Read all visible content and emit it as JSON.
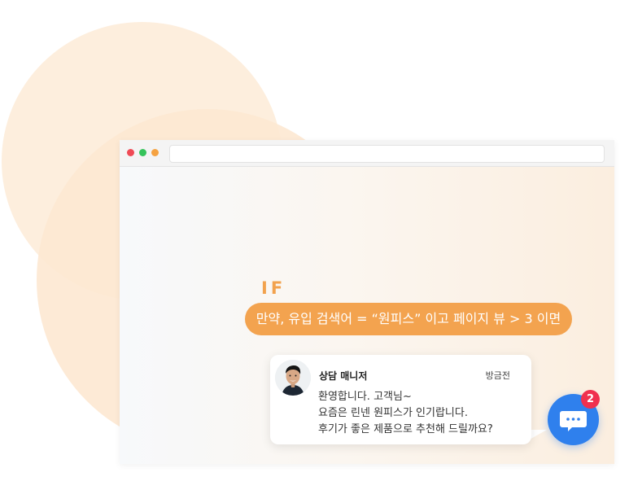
{
  "condition": {
    "keyword": "IF",
    "text": "만약, 유입 검색어 = “원피스” 이고 페이지 뷰 > 3 이면"
  },
  "chat": {
    "sender": "상담 매니저",
    "time": "방금전",
    "messages": [
      "환영합니다. 고객님~",
      "요즘은 린넨 원피스가 인기랍니다.",
      "후기가 좋은 제품으로 추천해 드릴까요?"
    ]
  },
  "chat_button": {
    "badge_count": "2",
    "icon": "chat-bubble-icon"
  },
  "colors": {
    "accent_orange": "#f3a34f",
    "chat_blue": "#2f80ed",
    "badge_red": "#f0304e"
  }
}
